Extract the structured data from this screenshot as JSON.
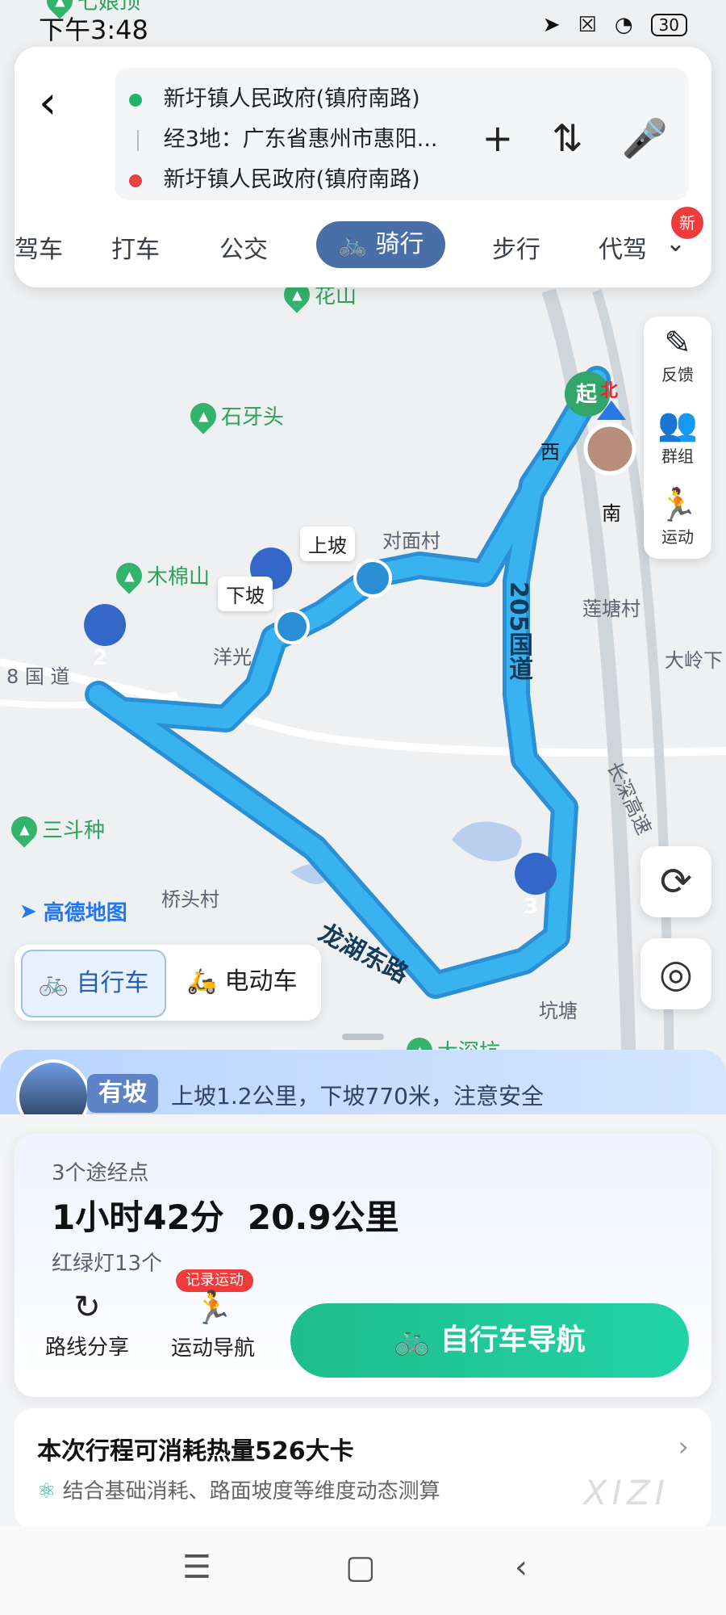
{
  "status": {
    "time": "下午3:48",
    "battery": "30"
  },
  "route": {
    "start": "新圩镇人民政府(镇府南路)",
    "via": "经3地：广东省惠州市惠阳...",
    "end": "新圩镇人民政府(镇府南路)"
  },
  "tabs": {
    "partial_left": "驾车",
    "taxi": "打车",
    "bus": "公交",
    "bike": "骑行",
    "walk": "步行",
    "partial_right": "代驾",
    "new_badge": "新"
  },
  "side_tools": [
    {
      "label": "反馈",
      "icon": "edit-icon"
    },
    {
      "label": "群组",
      "icon": "group-icon"
    },
    {
      "label": "运动",
      "icon": "sport-icon"
    }
  ],
  "map": {
    "labels": [
      "七娘顶",
      "花山",
      "石牙头",
      "木棉山",
      "对面村",
      "洋光",
      "8 国 道",
      "莲塘村",
      "大岭下",
      "三斗种",
      "桥头村",
      "坑塘",
      "大深坑",
      "长深高速"
    ],
    "roads": [
      "205国道",
      "龙湖东路"
    ],
    "markers": [
      "1",
      "2",
      "3"
    ],
    "callouts": [
      "上坡",
      "下坡"
    ],
    "start_marker": "起",
    "compass": {
      "north": "北",
      "west": "西",
      "south": "南"
    }
  },
  "logo": "高德地图",
  "vehicle": {
    "bike": "自行车",
    "ebike": "电动车"
  },
  "slope": {
    "tag": "有坡",
    "text": "上坡1.2公里，下坡770米，注意安全"
  },
  "summary": {
    "via_count": "3个途经点",
    "time": "1小时42分",
    "distance": "20.9公里",
    "lights": "红绿灯13个"
  },
  "actions": {
    "share": "路线分享",
    "sport_nav": "运动导航",
    "record_badge": "记录运动",
    "nav_button": "自行车导航"
  },
  "calorie": {
    "title": "本次行程可消耗热量526大卡",
    "subtitle": "结合基础消耗、路面坡度等维度动态测算",
    "watermark": "XIZI"
  },
  "nav_bar": {
    "menu": "☰",
    "home": "▢",
    "back": "‹"
  }
}
